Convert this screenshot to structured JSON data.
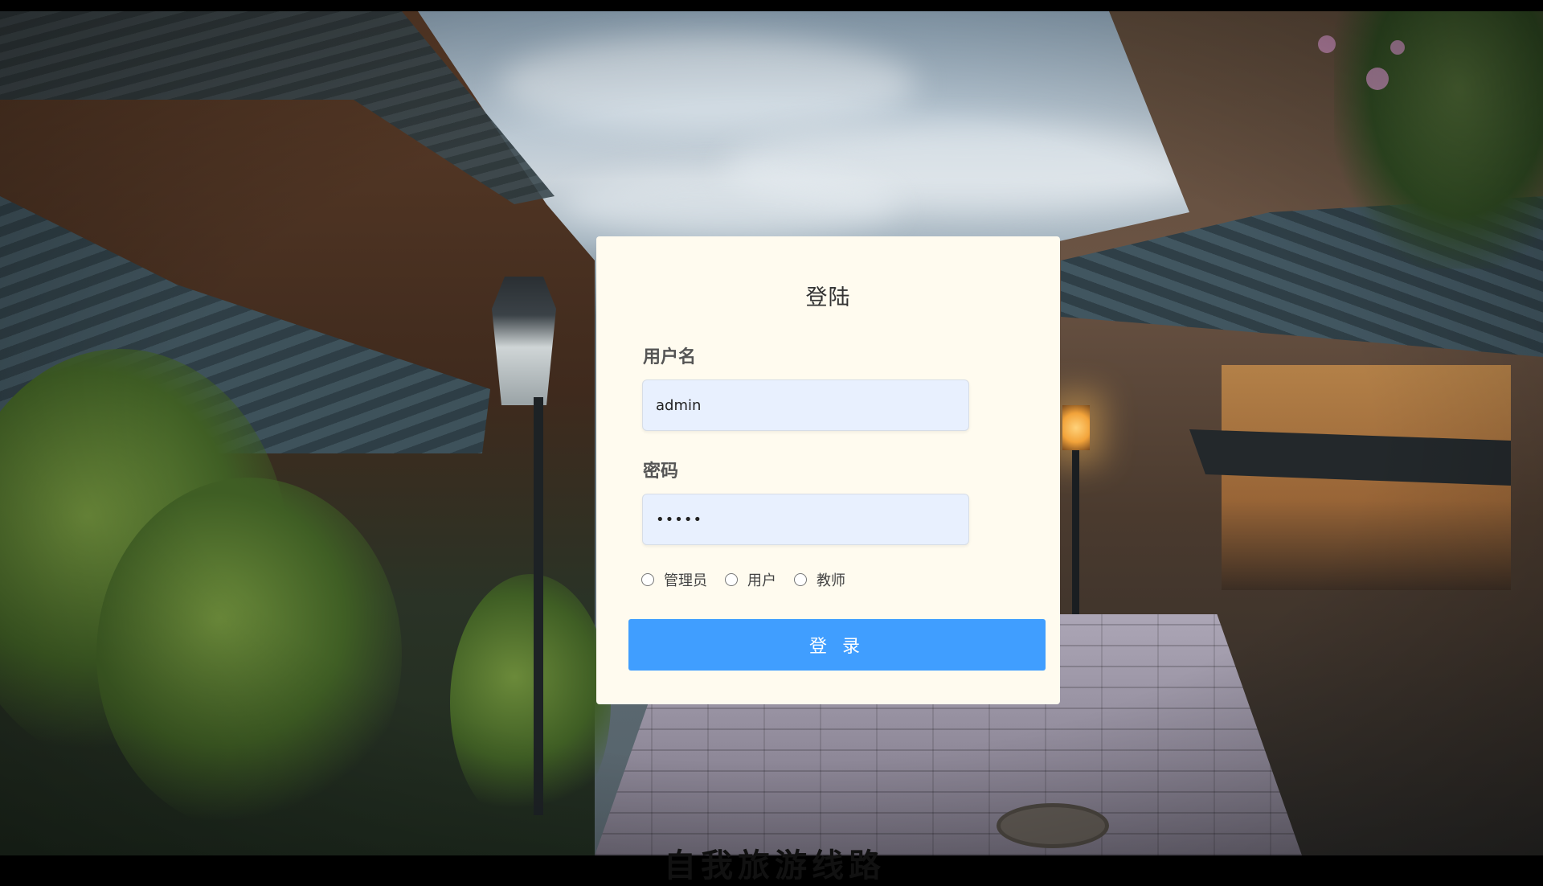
{
  "login": {
    "title": "登陆",
    "username_label": "用户名",
    "username_value": "admin",
    "password_label": "密码",
    "password_value": "•••••",
    "roles": [
      {
        "label": "管理员",
        "selected": false
      },
      {
        "label": "用户",
        "selected": false
      },
      {
        "label": "教师",
        "selected": false
      }
    ],
    "submit_label": "登 录"
  },
  "overlay": {
    "caption": "自我旅游线路"
  },
  "colors": {
    "card_background": "#fffbef",
    "input_background": "#e8f0fe",
    "button_primary": "#409eff"
  }
}
